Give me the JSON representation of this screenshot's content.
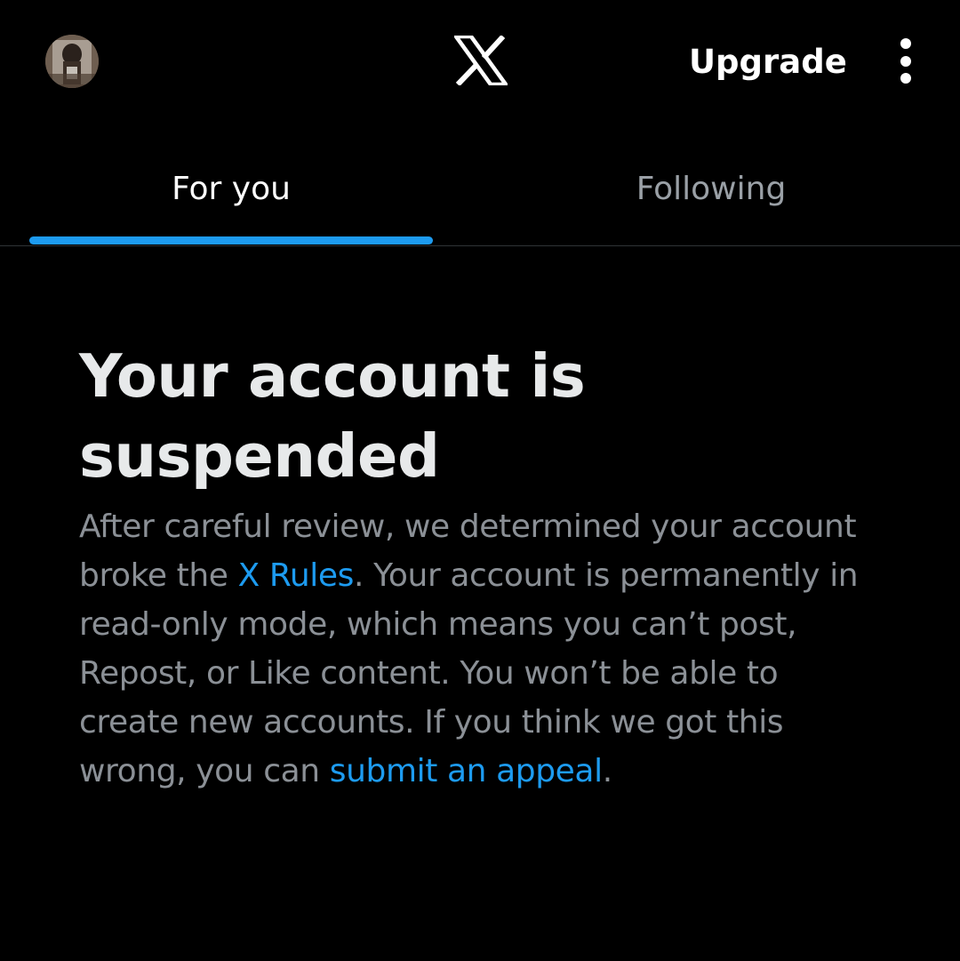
{
  "header": {
    "upgrade_label": "Upgrade",
    "icons": {
      "avatar": "profile-photo",
      "logo": "x-logo",
      "more": "vertical-ellipsis-icon"
    }
  },
  "tabs": [
    {
      "label": "For you",
      "selected": true
    },
    {
      "label": "Following",
      "selected": false
    }
  ],
  "notice": {
    "title": "Your account is suspended",
    "body_part1": "After careful review, we determined your account broke the ",
    "rules_link": "X Rules",
    "body_part2": ". Your account is permanently in read-only mode, which means you can’t post, Repost, or Like content. You won’t be able to create new accounts. If you think we got this wrong, you can ",
    "appeal_link": "submit an appeal",
    "body_end": "."
  },
  "colors": {
    "background": "#000000",
    "accent": "#1d9bf0",
    "primary_text": "#e7e9ea",
    "secondary_text": "#8b9096",
    "divider": "#2f3336"
  }
}
